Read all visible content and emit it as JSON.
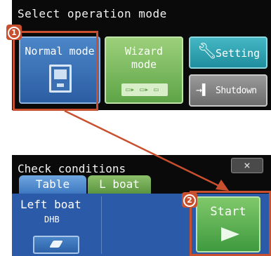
{
  "top_panel": {
    "title": "Select operation mode",
    "buttons": {
      "normal": "Normal mode",
      "wizard_line1": "Wizard",
      "wizard_line2": "mode",
      "setting": "Setting",
      "shutdown": "Shutdown"
    }
  },
  "bottom_panel": {
    "title": "Check conditions",
    "close_symbol": "×",
    "tabs": [
      "Table",
      "L boat"
    ],
    "left_boat_label": "Left boat",
    "left_boat_value": "DHB",
    "start_label": "Start"
  },
  "markers": {
    "step1": "1",
    "step2": "2"
  },
  "colors": {
    "highlight": "#c9502e",
    "panel_bg": "#0a0a0a",
    "content_bg": "#2b5aa8"
  }
}
